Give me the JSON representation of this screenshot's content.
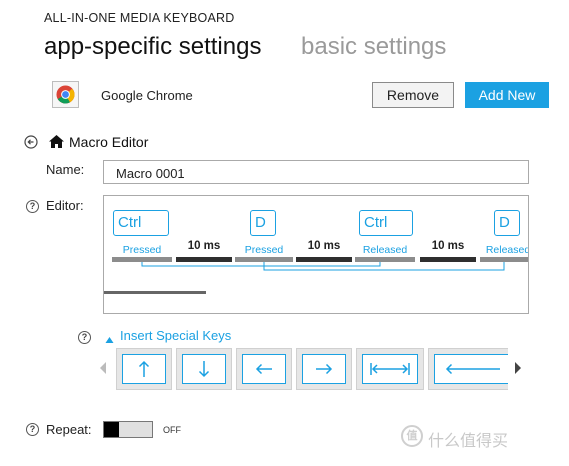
{
  "app_title": "ALL-IN-ONE MEDIA KEYBOARD",
  "tabs": [
    {
      "label": "app-specific settings",
      "active": true
    },
    {
      "label": "basic settings",
      "active": false
    }
  ],
  "app_row": {
    "app_name": "Google Chrome",
    "app_icon": "chrome-icon",
    "remove_label": "Remove",
    "add_label": "Add New"
  },
  "section": {
    "title": "Macro Editor",
    "back_icon": "back-arrow-icon",
    "home_icon": "home-icon"
  },
  "name_field": {
    "label": "Name:",
    "value": "Macro 0001"
  },
  "editor": {
    "label": "Editor:",
    "steps": [
      {
        "key": "Ctrl",
        "action": "Pressed"
      },
      {
        "delay": "10 ms"
      },
      {
        "key": "D",
        "action": "Pressed"
      },
      {
        "delay": "10 ms"
      },
      {
        "key": "Ctrl",
        "action": "Released"
      },
      {
        "delay": "10 ms"
      },
      {
        "key": "D",
        "action": "Released"
      }
    ]
  },
  "special_keys": {
    "header": "Insert Special Keys",
    "keys": [
      "up-arrow-key-icon",
      "down-arrow-key-icon",
      "left-arrow-key-icon",
      "right-arrow-key-icon",
      "tab-key-icon",
      "backspace-key-icon"
    ]
  },
  "repeat": {
    "label": "Repeat:",
    "state": "OFF"
  },
  "help_icon_glyph": "?",
  "colors": {
    "accent": "#1ba1e2",
    "inactive_tab": "#9a9a9a"
  },
  "watermark": {
    "text": "值 什么值得买",
    "logo_glyph": "值"
  }
}
